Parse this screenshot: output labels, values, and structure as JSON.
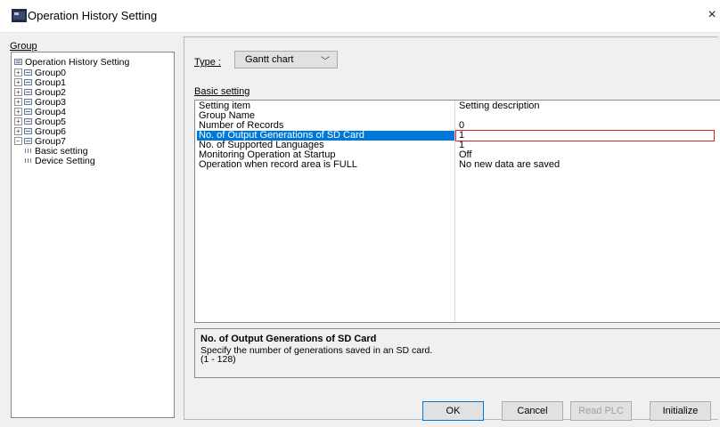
{
  "window": {
    "title": "Operation History Setting",
    "close_glyph": "×"
  },
  "colors": {
    "selection": "#0078d7",
    "highlight": "#e02a2a",
    "window_bg": "#f0f0f0"
  },
  "tree": {
    "label": "Group",
    "root": "Operation History Setting",
    "groups": [
      "Group0",
      "Group1",
      "Group2",
      "Group3",
      "Group4",
      "Group5",
      "Group6",
      "Group7"
    ],
    "group7_children": [
      "Basic setting",
      "Device Setting"
    ]
  },
  "type_field": {
    "label": "Type :",
    "value": "Gantt chart"
  },
  "basic_setting_label": "Basic setting",
  "grid": {
    "headers": [
      "Setting item",
      "Setting description"
    ],
    "rows": [
      {
        "item": "Group Name",
        "value": ""
      },
      {
        "item": "Number of Records",
        "value": "0"
      },
      {
        "item": "No. of Output Generations of SD Card",
        "value": "1"
      },
      {
        "item": "No. of Supported Languages",
        "value": "1"
      },
      {
        "item": "Monitoring Operation at Startup",
        "value": "Off"
      },
      {
        "item": "Operation when record area is FULL",
        "value": "No new data are saved"
      }
    ]
  },
  "description": {
    "title": "No. of Output Generations of SD Card",
    "line1": "Specify the number of generations saved in an SD card.",
    "line2": "(1 - 128)"
  },
  "buttons": {
    "ok": "OK",
    "cancel": "Cancel",
    "read_plc": "Read PLC",
    "initialize": "Initialize"
  }
}
